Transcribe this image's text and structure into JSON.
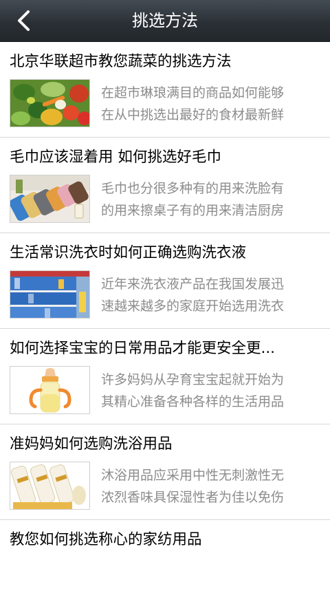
{
  "header": {
    "title": "挑选方法",
    "back_icon": "chevron-left-icon"
  },
  "articles": [
    {
      "title": "北京华联超市教您蔬菜的挑选方法",
      "summary_line1": "在超市琳琅满目的商品如何能够",
      "summary_line2": "在从中挑选出最好的食材最新鲜",
      "thumbnail": "vegetables-image"
    },
    {
      "title": "毛巾应该湿着用 如何挑选好毛巾",
      "summary_line1": "毛巾也分很多种有的用来洗脸有",
      "summary_line2": "的用来擦桌子有的用来清洁厨房",
      "thumbnail": "towels-image"
    },
    {
      "title": "生活常识洗衣时如何正确选购洗衣液",
      "summary_line1": "近年来洗衣液产品在我国发展迅",
      "summary_line2": "速越来越多的家庭开始选用洗衣",
      "thumbnail": "detergent-shelf-image"
    },
    {
      "title": "如何选择宝宝的日常用品才能更安全更...",
      "summary_line1": "许多妈妈从孕育宝宝起就开始为",
      "summary_line2": "其精心准备各种各样的生活用品",
      "thumbnail": "baby-bottle-image"
    },
    {
      "title": "准妈妈如何选购洗浴用品",
      "summary_line1": "沐浴用品应采用中性无刺激性无",
      "summary_line2": "浓烈香味具保湿性者为佳以免伤",
      "thumbnail": "bath-products-image"
    },
    {
      "title": "教您如何挑选称心的家纺用品"
    }
  ]
}
